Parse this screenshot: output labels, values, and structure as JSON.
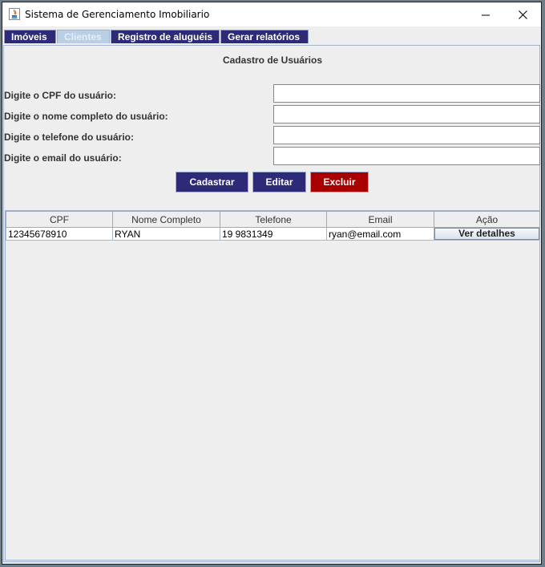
{
  "window": {
    "title": "Sistema de Gerenciamento Imobiliario",
    "controls": {
      "minimize": "—",
      "maximize": "☐",
      "close": "✕"
    }
  },
  "tabs": [
    {
      "label": "Imóveis",
      "active": false
    },
    {
      "label": "Clientes",
      "active": true
    },
    {
      "label": "Registro de aluguéis",
      "active": false
    },
    {
      "label": "Gerar relatórios",
      "active": false
    }
  ],
  "form": {
    "title": "Cadastro de Usuários",
    "fields": [
      {
        "label": "Digite o CPF do usuário:",
        "value": ""
      },
      {
        "label": "Digite o nome completo do usuário:",
        "value": ""
      },
      {
        "label": "Digite o telefone do usuário:",
        "value": ""
      },
      {
        "label": "Digite o email do usuário:",
        "value": ""
      }
    ],
    "buttons": {
      "cadastrar": "Cadastrar",
      "editar": "Editar",
      "excluir": "Excluir"
    }
  },
  "table": {
    "columns": [
      "CPF",
      "Nome Completo",
      "Telefone",
      "Email",
      "Ação"
    ],
    "rows": [
      {
        "cpf": "12345678910",
        "nome": "RYAN",
        "telefone": "19 9831349",
        "email": "ryan@email.com",
        "acao": "Ver detalhes"
      }
    ]
  },
  "colors": {
    "tab_bg": "#2d2a78",
    "tab_active_bg": "#b8cfe5",
    "primary_button": "#2d2a78",
    "danger_button": "#a80000"
  }
}
